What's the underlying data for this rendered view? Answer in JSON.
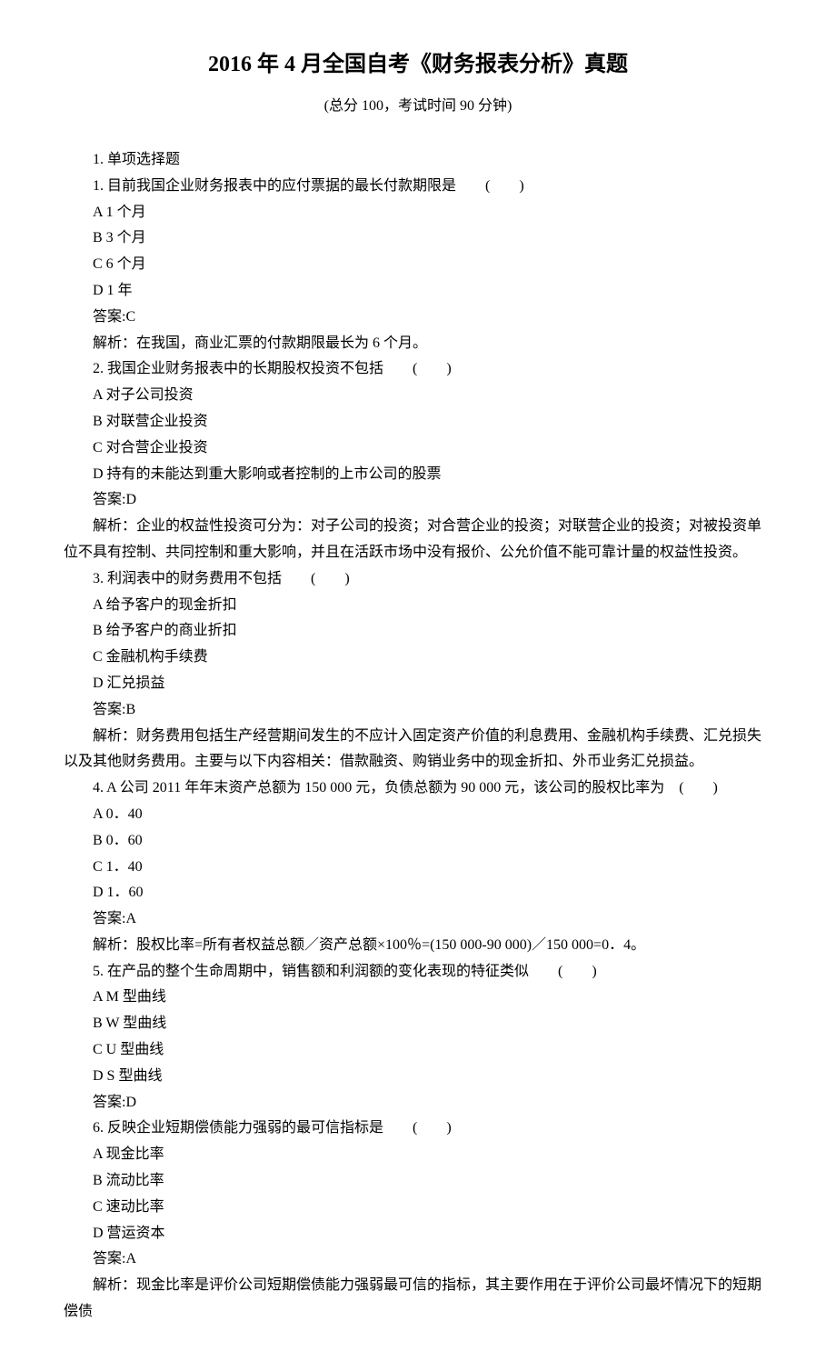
{
  "title": "2016 年 4 月全国自考《财务报表分析》真题",
  "subtitle": "(总分 100，考试时间 90 分钟)",
  "section_header": "1. 单项选择题",
  "questions": [
    {
      "stem": "1. 目前我国企业财务报表中的应付票据的最长付款期限是　　(　　)",
      "options": [
        "A 1 个月",
        "B 3 个月",
        "C 6 个月",
        "D 1 年"
      ],
      "answer": "答案:C",
      "explain": "解析：在我国，商业汇票的付款期限最长为 6 个月。"
    },
    {
      "stem": "2. 我国企业财务报表中的长期股权投资不包括　　(　　)",
      "options": [
        "A 对子公司投资",
        "B 对联营企业投资",
        "C 对合营企业投资",
        "D 持有的未能达到重大影响或者控制的上市公司的股票"
      ],
      "answer": "答案:D",
      "explain": "解析：企业的权益性投资可分为：对子公司的投资；对合营企业的投资；对联营企业的投资；对被投资单位不具有控制、共同控制和重大影响，并且在活跃市场中没有报价、公允价值不能可靠计量的权益性投资。"
    },
    {
      "stem": "3. 利润表中的财务费用不包括　　(　　)",
      "options": [
        "A 给予客户的现金折扣",
        "B 给予客户的商业折扣",
        "C 金融机构手续费",
        "D 汇兑损益"
      ],
      "answer": "答案:B",
      "explain": "解析：财务费用包括生产经营期间发生的不应计入固定资产价值的利息费用、金融机构手续费、汇兑损失以及其他财务费用。主要与以下内容相关：借款融资、购销业务中的现金折扣、外币业务汇兑损益。"
    },
    {
      "stem": "4. A 公司 2011 年年末资产总额为 150 000 元，负债总额为 90 000 元，该公司的股权比率为　(　　)",
      "options": [
        "A 0．40",
        "B 0．60",
        "C 1．40",
        "D 1．60"
      ],
      "answer": "答案:A",
      "explain": "解析：股权比率=所有者权益总额／资产总额×100％=(150 000-90 000)／150 000=0．4。"
    },
    {
      "stem": "5. 在产品的整个生命周期中，销售额和利润额的变化表现的特征类似　　(　　)",
      "options": [
        "A M 型曲线",
        "B W 型曲线",
        "C U 型曲线",
        "D S 型曲线"
      ],
      "answer": "答案:D",
      "explain": ""
    },
    {
      "stem": "6. 反映企业短期偿债能力强弱的最可信指标是　　(　　)",
      "options": [
        "A 现金比率",
        "B 流动比率",
        "C 速动比率",
        "D 营运资本"
      ],
      "answer": "答案:A",
      "explain": "解析：现金比率是评价公司短期偿债能力强弱最可信的指标，其主要作用在于评价公司最坏情况下的短期偿债"
    }
  ]
}
